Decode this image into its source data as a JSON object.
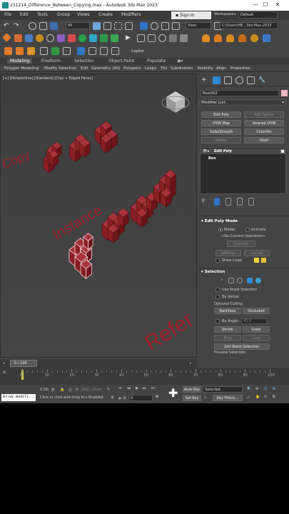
{
  "titlebar": {
    "title": "231214_Difference_Between_Copying.max - Autodesk 3ds Max 2023",
    "minimize": "—",
    "maximize": "☐",
    "close": "✕"
  },
  "menu": [
    "File",
    "Edit",
    "Tools",
    "Group",
    "Views",
    "Create",
    "Modifiers"
  ],
  "signin": {
    "label": "Sign In"
  },
  "workspaces": {
    "label": "Workspaces:",
    "value": "Default"
  },
  "toolbar": {
    "selection_filter": "All",
    "view_dropdown": "View",
    "path_field": "C:\\Users\\HE...3ds Max 2023"
  },
  "copitor": "Copitor",
  "ribbon_tabs": [
    "Modeling",
    "Freeform",
    "Selection",
    "Object Paint",
    "Populate"
  ],
  "ribbon_row": [
    "Polygon Modeling",
    "Modify Selection",
    "Edit",
    "Geometry (All)",
    "Polygons",
    "Loops",
    "Tris",
    "Subdivision",
    "Visibility",
    "Align",
    "Properties"
  ],
  "viewport": {
    "label": "[+] [Perspective] [Standard] [Clay + Edged Faces]",
    "texts": {
      "copy": "Copy",
      "instance": "Instance",
      "reference": "Refer"
    },
    "colors": {
      "bg": "#3e3e3e",
      "cube": "#8b1e25",
      "cube_top": "#a8323a"
    }
  },
  "command_panel": {
    "object_name": "Box002",
    "object_color": "#f0b4c0",
    "modifier_list": "Modifier List",
    "buttons": [
      {
        "label": "Edit Poly",
        "enabled": true
      },
      {
        "label": "Edit Spline",
        "enabled": false
      },
      {
        "label": "UVW Map",
        "enabled": true
      },
      {
        "label": "Unwrap UVW",
        "enabled": true
      },
      {
        "label": "TurboSmooth",
        "enabled": true
      },
      {
        "label": "Chamfer",
        "enabled": true
      },
      {
        "label": "Sweep",
        "enabled": false
      },
      {
        "label": "Shell",
        "enabled": true
      }
    ],
    "stack": [
      "Edit Poly",
      "Box"
    ],
    "edit_poly_mode": {
      "title": "Edit Poly Mode",
      "model": "Model",
      "animate": "Animate",
      "no_op": "<No Current Operation>",
      "commit": "Commit",
      "settings": "Settings",
      "cancel": "Cancel",
      "show_cage": "Show Cage"
    },
    "selection": {
      "title": "Selection",
      "use_stack": "Use Stack Selection",
      "by_vertex": "By Vertex",
      "optional_culling": "Optional Culling",
      "backface": "Backface",
      "occluded": "Occluded",
      "by_angle": "By Angle:",
      "angle_value": "45.0",
      "shrink": "Shrink",
      "grow": "Grow",
      "ring": "Ring",
      "loop": "Loop",
      "get_stack": "Get Stack Selection",
      "preview": "Preview Selection"
    }
  },
  "timeline": {
    "frame": "0 / 100",
    "ticks": [
      "0",
      "10",
      "20",
      "30",
      "40",
      "50",
      "60",
      "70",
      "80",
      "90",
      "100"
    ]
  },
  "status": {
    "script_field": "Array modifi...",
    "selected": "1 Ob",
    "x_label": "X:",
    "x_value": "2431.15um",
    "y_label": "Y:",
    "hint": "Click or click-and-drag to s",
    "enabled": "Enabled:",
    "auto_key": "Auto Key",
    "set_key": "Set Key",
    "key_dropdown": "Selected",
    "key_filters": "Key Filters...",
    "frame_value": "0"
  }
}
